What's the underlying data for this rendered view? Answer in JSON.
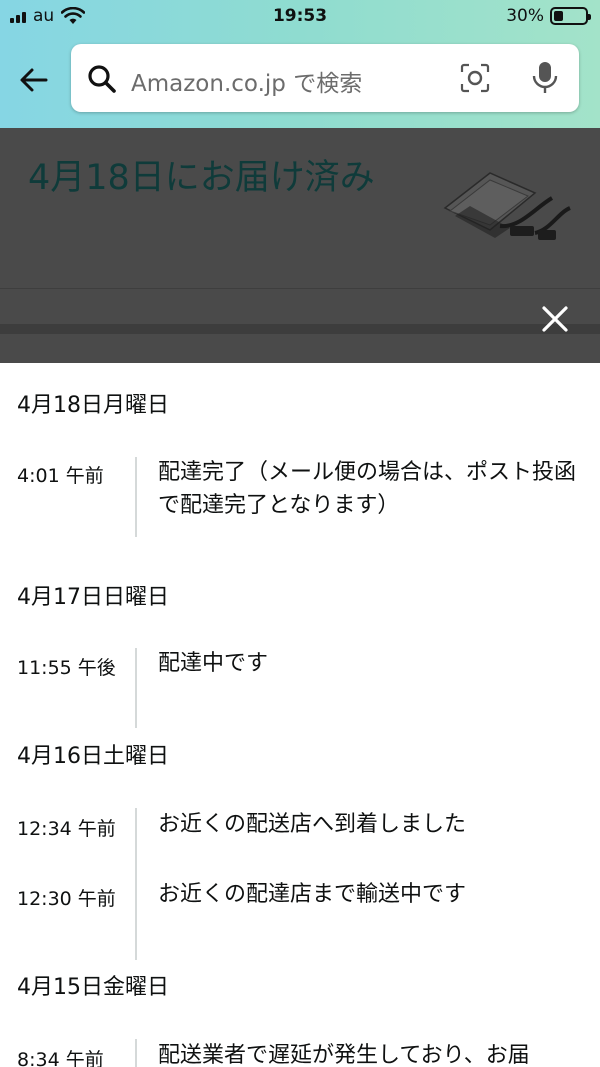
{
  "status": {
    "carrier": "au",
    "time": "19:53",
    "battery": "30%",
    "battery_level": 0.3
  },
  "search": {
    "placeholder": "Amazon.co.jp で検索"
  },
  "order": {
    "delivered_title": "4月18日にお届け済み"
  },
  "timeline": {
    "days": [
      {
        "date": "4月18日月曜日",
        "events": [
          {
            "time": "4:01 午前",
            "text": "配達完了（メール便の場合は、ポスト投函で配達完了となります）"
          }
        ]
      },
      {
        "date": "4月17日日曜日",
        "events": [
          {
            "time": "11:55 午後",
            "text": "配達中です"
          }
        ]
      },
      {
        "date": "4月16日土曜日",
        "events": [
          {
            "time": "12:34 午前",
            "text": "お近くの配送店へ到着しました"
          },
          {
            "time": "12:30 午前",
            "text": "お近くの配達店まで輸送中です"
          }
        ]
      },
      {
        "date": "4月15日金曜日",
        "events": [
          {
            "time": "8:34 午前",
            "text": "配送業者で遅延が発生しており、お届"
          }
        ]
      }
    ]
  },
  "colors": {
    "header_gradient_start": "#86d6e4",
    "header_gradient_end": "#a3e3c9",
    "overlay": "#4a4a4a",
    "title_teal": "#0f3b3a"
  },
  "icons": [
    "back-arrow-icon",
    "search-icon",
    "camera-scan-icon",
    "microphone-icon",
    "close-icon",
    "wifi-icon",
    "signal-icon",
    "battery-icon"
  ]
}
